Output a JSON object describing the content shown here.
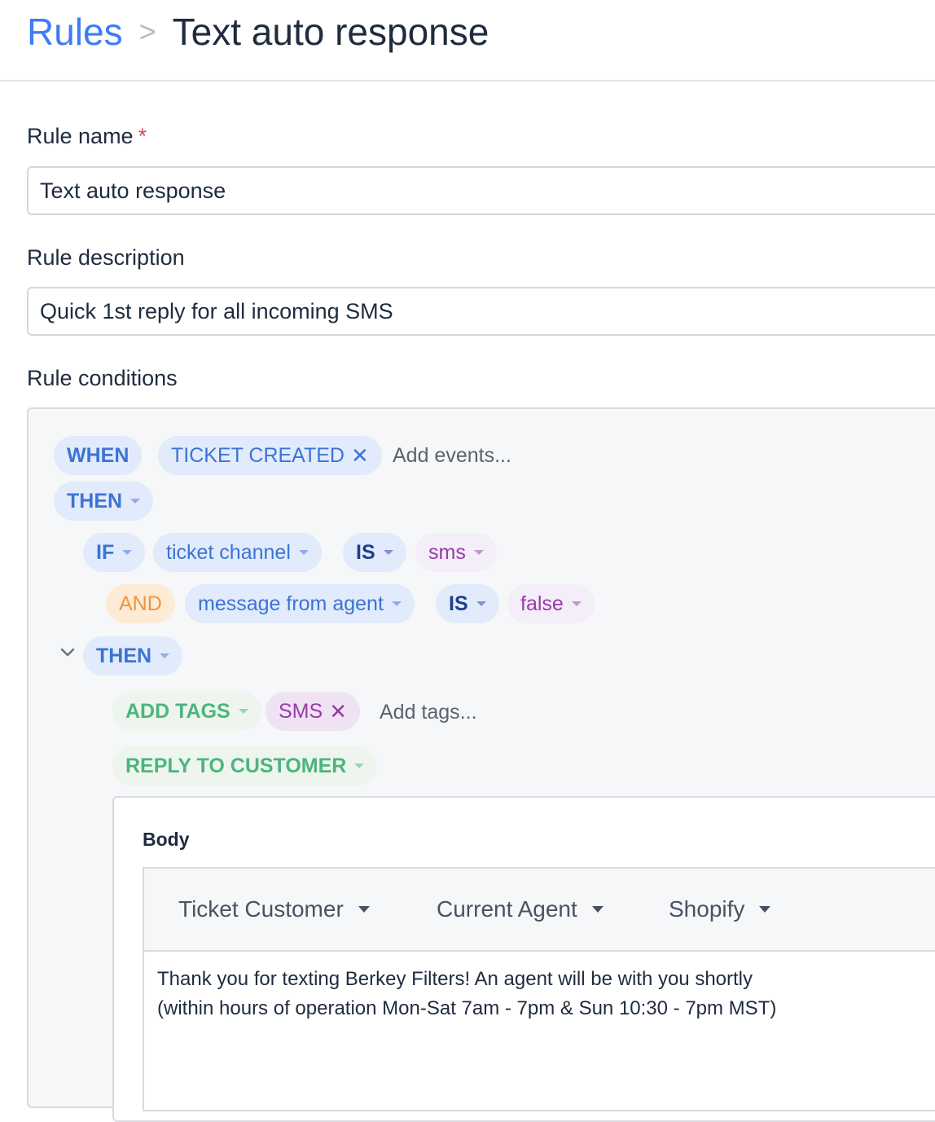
{
  "breadcrumb": {
    "root": "Rules",
    "separator": ">",
    "current": "Text auto response"
  },
  "fields": {
    "rule_name": {
      "label": "Rule name",
      "required_mark": "*",
      "value": "Text auto response"
    },
    "rule_description": {
      "label": "Rule description",
      "value": "Quick 1st reply for all incoming SMS"
    },
    "rule_conditions": {
      "label": "Rule conditions"
    }
  },
  "conditions": {
    "when": "WHEN",
    "event": "TICKET CREATED",
    "add_events_placeholder": "Add events...",
    "then_1": "THEN",
    "if": "IF",
    "if_field": "ticket channel",
    "if_operator": "IS",
    "if_value": "sms",
    "and": "AND",
    "and_field": "message from agent",
    "and_operator": "IS",
    "and_value": "false",
    "then_2": "THEN",
    "add_tags": "ADD TAGS",
    "tag": "SMS",
    "add_tags_placeholder": "Add tags...",
    "reply_to_customer": "REPLY TO CUSTOMER"
  },
  "body": {
    "label": "Body",
    "toolbar": [
      "Ticket Customer",
      "Current Agent",
      "Shopify"
    ],
    "text_lines": [
      "Thank you for texting Berkey Filters! An agent will be with you shortly",
      "(within hours of operation Mon-Sat 7am - 7pm & Sun 10:30 - 7pm MST)"
    ]
  },
  "icons": {
    "remove": "close-icon",
    "dropdown": "caret-down-icon",
    "collapse": "chevron-down-icon"
  },
  "colors": {
    "link_blue": "#3e7bf5",
    "pill_blue_bg": "#e1ebfb",
    "pill_purple": "#9a3aa8",
    "pill_orange": "#f0953e",
    "pill_green": "#4cb57c",
    "required_red": "#e0465f"
  }
}
